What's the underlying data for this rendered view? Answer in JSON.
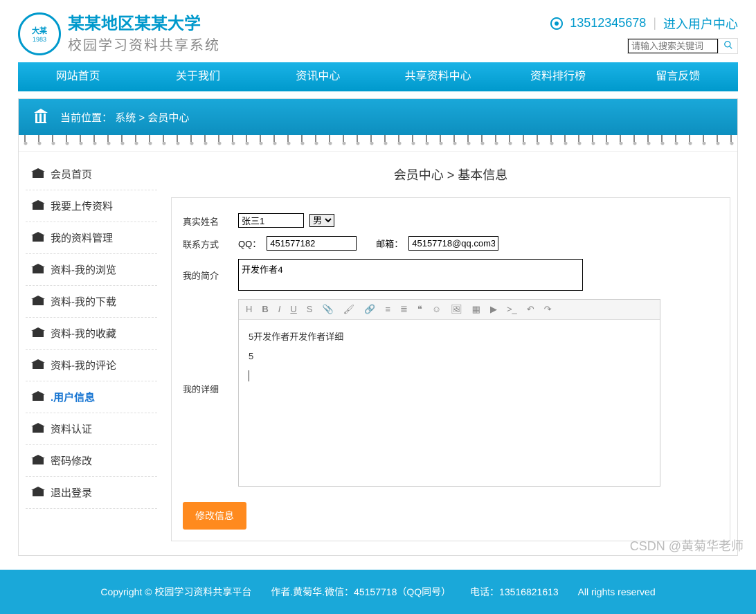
{
  "header": {
    "title": "某某地区某某大学",
    "subtitle": "校园学习资料共享系统",
    "phone": "13512345678",
    "separator": "|",
    "user_center_link": "进入用户中心",
    "search_placeholder": "请输入搜索关键词"
  },
  "nav": [
    "网站首页",
    "关于我们",
    "资讯中心",
    "共享资料中心",
    "资料排行榜",
    "留言反馈"
  ],
  "breadcrumb": {
    "prefix": "当前位置：",
    "path1": "系统",
    "sep": ">",
    "path2": "会员中心"
  },
  "sidebar": {
    "items": [
      {
        "label": "会员首页"
      },
      {
        "label": "我要上传资料"
      },
      {
        "label": "我的资料管理"
      },
      {
        "label": "资料-我的浏览"
      },
      {
        "label": "资料-我的下载"
      },
      {
        "label": "资料-我的收藏"
      },
      {
        "label": "资料-我的评论"
      },
      {
        "label": ".用户信息"
      },
      {
        "label": "资料认证"
      },
      {
        "label": "密码修改"
      },
      {
        "label": "退出登录"
      }
    ],
    "active_index": 7
  },
  "page_title": "会员中心 > 基本信息",
  "form": {
    "name_label": "真实姓名",
    "name_value": "张三1",
    "gender_value": "男",
    "contact_label": "联系方式",
    "qq_label": "QQ：",
    "qq_value": "451577182",
    "email_label": "邮箱：",
    "email_value": "45157718@qq.com3",
    "brief_label": "我的简介",
    "brief_value": "开发作者4",
    "detail_label": "我的详细",
    "detail_line1": "5开发作者开发作者详细",
    "detail_line2": "5",
    "submit": "修改信息"
  },
  "footer": {
    "copyright": "Copyright © 校园学习资料共享平台",
    "author": "作者.黄菊华.微信：45157718（QQ同号）",
    "tel": "电话：13516821613",
    "rights": "All rights reserved"
  },
  "watermark": "CSDN @黄菊华老师"
}
